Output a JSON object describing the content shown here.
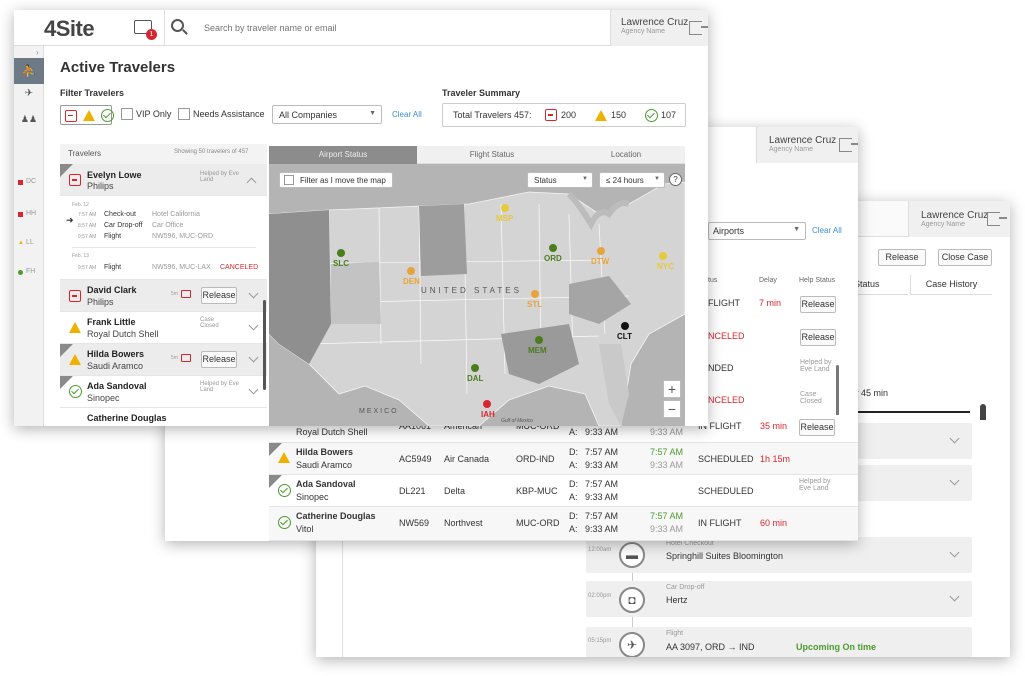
{
  "w3": {
    "user_name": "Lawrence Cruz",
    "user_role": "Agency Name",
    "airports_label": "Airports",
    "clear_all": "Clear All",
    "release": "Release",
    "close_case": "Close Case",
    "col_status": "nt Status",
    "col_history": "Case History",
    "delay_text": "y 45 min",
    "timeline": [
      {
        "time": "12:00am",
        "type": "Hotel Checkout",
        "value": "Springhill Suites Bloomington",
        "icon": "bed-icon"
      },
      {
        "time": "02:00pm",
        "type": "Car Drop-off",
        "value": "Hertz",
        "icon": "car-icon"
      },
      {
        "time": "05:15pm",
        "type": "Flight",
        "value": "AA 3097, ORD → IND",
        "icon": "plane-icon"
      }
    ],
    "upcoming": "Upcoming On time"
  },
  "w2": {
    "user_name": "Lawrence Cruz",
    "user_role": "Agency Name",
    "col_status": "tus",
    "col_delay": "Delay",
    "col_help": "Help Status",
    "top_rows": [
      {
        "status": "FLIGHT",
        "delay": "7 min",
        "help": "",
        "btn": "Release"
      },
      {
        "status": "NCELED",
        "delay": "",
        "help": "",
        "btn": "Release"
      },
      {
        "status": "NDED",
        "delay": "",
        "help": "Helped by Eve Land",
        "btn": ""
      },
      {
        "status": "NCELED",
        "delay": "",
        "help": "Case Closed",
        "btn": ""
      }
    ],
    "rows": [
      {
        "name": "",
        "company": "Royal Dutch Shell",
        "flight": "AA1061",
        "airline": "American",
        "route": "MUC-ORD",
        "d_sched": "",
        "d_act": "",
        "a_sched": "9:33 AM",
        "a_act": "9:33 AM",
        "status": "IN FLIGHT",
        "delay": "35 min",
        "help": "",
        "btn": "Release",
        "icon": "warn",
        "vip": false
      },
      {
        "name": "Hilda Bowers",
        "company": "Saudi Aramco",
        "flight": "AC5949",
        "airline": "Air Canada",
        "route": "ORD-IND",
        "d_sched": "7:57 AM",
        "d_act": "7:57 AM",
        "a_sched": "9:33 AM",
        "a_act": "9:33 AM",
        "status": "SCHEDULED",
        "delay": "1h 15m",
        "help": "",
        "btn": "",
        "icon": "warn",
        "vip": true
      },
      {
        "name": "Ada Sandoval",
        "company": "Sinopec",
        "flight": "DL221",
        "airline": "Delta",
        "route": "KBP-MUC",
        "d_sched": "7:57 AM",
        "d_act": "",
        "a_sched": "9:33 AM",
        "a_act": "",
        "status": "SCHEDULED",
        "delay": "",
        "help": "Helped by Eve Land",
        "btn": "",
        "icon": "ok",
        "vip": true
      },
      {
        "name": "Catherine Douglas",
        "company": "Vitol",
        "flight": "NW569",
        "airline": "Northvest",
        "route": "MUC-ORD",
        "d_sched": "7:57 AM",
        "d_act": "7:57 AM",
        "a_sched": "9:33 AM",
        "a_act": "9:33 AM",
        "status": "IN FLIGHT",
        "delay": "60 min",
        "help": "",
        "btn": "",
        "icon": "ok",
        "vip": false
      }
    ],
    "d_label": "D:",
    "a_label": "A:"
  },
  "w1": {
    "logo": "4Site",
    "badge": "1",
    "search_placeholder": "Search by traveler name or email",
    "user_name": "Lawrence Cruz",
    "user_role": "Agency Name",
    "title": "Active Travelers",
    "filter_title": "Filter Travelers",
    "vip_only": "VIP Only",
    "needs_assistance": "Needs Assistance",
    "companies": "All Companies",
    "clear_all": "Clear All",
    "summary_title": "Traveler Summary",
    "total": "Total Travelers 457:",
    "count_red": "200",
    "count_warn": "150",
    "count_ok": "107",
    "travelers_label": "Travelers",
    "showing": "Showing 50 travelers of 457",
    "tabs": [
      "Airport Status",
      "Flight Status",
      "Location"
    ],
    "filter_map": "Filter as I move the map",
    "status_select": "Status",
    "hours_select": "≤ 24 hours",
    "help": "?",
    "sidebar_labels": [
      "DC",
      "HH",
      "LL",
      "FH"
    ],
    "evelyn": {
      "name": "Evelyn Lowe",
      "company": "Philips",
      "help": "Helped by Eve Land",
      "date1": "Feb. 12",
      "date2": "Feb. 13",
      "events": [
        {
          "time": "7:57 AM",
          "type": "Check-out",
          "detail": "Hotel California"
        },
        {
          "time": "8:57 AM",
          "type": "Car Drop-off",
          "detail": "Car Office"
        },
        {
          "time": "9:57 AM",
          "type": "Flight",
          "detail": "NW596, MUC-ORD"
        }
      ],
      "last": {
        "time": "9:57 AM",
        "type": "Flight",
        "detail": "NW596, MUC-LAX",
        "status": "CANCELED"
      }
    },
    "travelers": [
      {
        "name": "David Clark",
        "company": "Philips",
        "help": "",
        "btn": "Release",
        "msg": "5m"
      },
      {
        "name": "Frank Little",
        "company": "Royal Dutch Shell",
        "help": "Case Closed",
        "btn": "",
        "msg": ""
      },
      {
        "name": "Hilda Bowers",
        "company": "Saudi Aramco",
        "help": "",
        "btn": "Release",
        "msg": "5m"
      },
      {
        "name": "Ada Sandoval",
        "company": "Sinopec",
        "help": "Helped by Eve Land",
        "btn": "",
        "msg": ""
      },
      {
        "name": "Catherine Douglas",
        "company": "",
        "help": "",
        "btn": "",
        "msg": ""
      }
    ],
    "map_labels": {
      "country": "UNITED STATES",
      "mexico": "MEXICO",
      "gulf": "Gulf of Mexico"
    },
    "cities": [
      {
        "code": "SLC",
        "color": "#4b7d1d"
      },
      {
        "code": "DEN",
        "color": "#e8a43a"
      },
      {
        "code": "MSP",
        "color": "#e8c93a"
      },
      {
        "code": "ORD",
        "color": "#4b7d1d"
      },
      {
        "code": "DTW",
        "color": "#e8a43a"
      },
      {
        "code": "NYC",
        "color": "#e8c93a"
      },
      {
        "code": "STL",
        "color": "#e8a43a"
      },
      {
        "code": "CLT",
        "color": "#111111"
      },
      {
        "code": "MEM",
        "color": "#4b7d1d"
      },
      {
        "code": "DAL",
        "color": "#4b7d1d"
      },
      {
        "code": "IAH",
        "color": "#d8262e"
      }
    ]
  }
}
